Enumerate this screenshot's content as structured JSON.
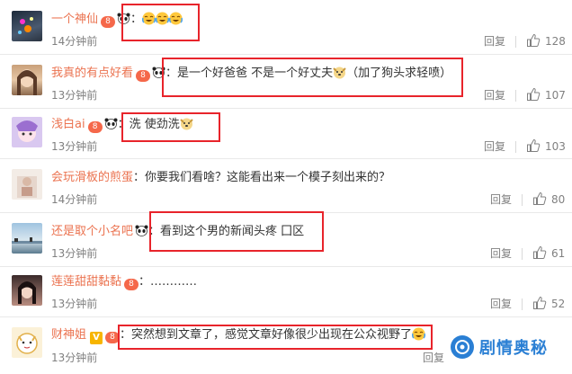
{
  "comments": [
    {
      "username": "一个神仙",
      "badge_text": "8",
      "text": "：",
      "time": "14分钟前",
      "reply": "回复",
      "likes": "128"
    },
    {
      "username": "我真的有点好看",
      "badge_text": "8",
      "text": "：是一个好爸爸 不是一个好丈夫",
      "text_suffix": "（加了狗头求轻喷）",
      "time": "13分钟前",
      "reply": "回复",
      "likes": "107"
    },
    {
      "username": "浅白ai",
      "badge_text": "8",
      "text": "：洗 使劲洗",
      "time": "13分钟前",
      "reply": "回复",
      "likes": "103"
    },
    {
      "username": "会玩滑板的煎蛋",
      "text": "：你要我们看啥？这能看出来一个模子刻出来的？",
      "time": "14分钟前",
      "reply": "回复",
      "likes": "80"
    },
    {
      "username": "还是取个小名吧",
      "text": "：看到这个男的新闻头疼 囗区",
      "time": "13分钟前",
      "reply": "回复",
      "likes": "61"
    },
    {
      "username": "莲莲甜甜黏黏",
      "badge_text": "8",
      "text": "：…………",
      "time": "13分钟前",
      "reply": "回复",
      "likes": "52"
    },
    {
      "username": "财神姐",
      "v_badge": "V",
      "badge_text": "8",
      "text": "：突然想到文章了，感觉文章好像很少出现在公众视野了",
      "time": "13分钟前",
      "reply": "回复"
    }
  ],
  "watermark": {
    "text": "剧情奥秘"
  },
  "colors": {
    "username": "#eb7350",
    "highlight": "#e8242b",
    "muted": "#808080",
    "watermark": "#2a7fd4"
  }
}
